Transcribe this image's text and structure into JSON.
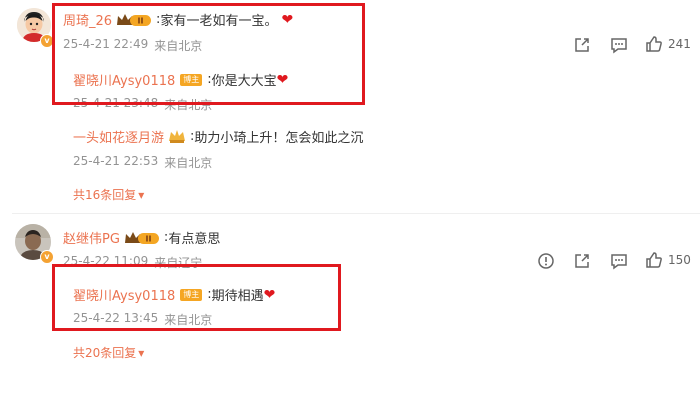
{
  "comments": [
    {
      "username": "周琦_26",
      "separator": ":",
      "text": "家有一老如有一宝。",
      "emoji": "❤",
      "time": "25-4-21 22:49",
      "location": "来自北京",
      "likes": "241",
      "replies": [
        {
          "username": "翟晓川Aysy0118",
          "badge": "博主",
          "separator": ":",
          "text": "你是大大宝",
          "emoji": "❤",
          "time": "25-4-21 23:48",
          "location": "来自北京"
        },
        {
          "username": "一头如花逐月游",
          "separator": ":",
          "text": "助力小琦上升！怎会如此之沉",
          "time": "25-4-21 22:53",
          "location": "来自北京"
        }
      ],
      "more_replies": "共16条回复"
    },
    {
      "username": "赵继伟PG",
      "separator": ":",
      "text": "有点意思",
      "time": "25-4-22 11:09",
      "location": "来自辽宁",
      "likes": "150",
      "replies": [
        {
          "username": "翟晓川Aysy0118",
          "badge": "博主",
          "separator": ":",
          "text": "期待相遇",
          "emoji": "❤",
          "time": "25-4-22 13:45",
          "location": "来自北京"
        }
      ],
      "more_replies": "共20条回复"
    }
  ],
  "icons": {
    "dropdown": "▾",
    "verify": "v"
  },
  "colors": {
    "username": "#eb7350",
    "highlight_box": "#e0191f",
    "badge": "#f5a623"
  }
}
